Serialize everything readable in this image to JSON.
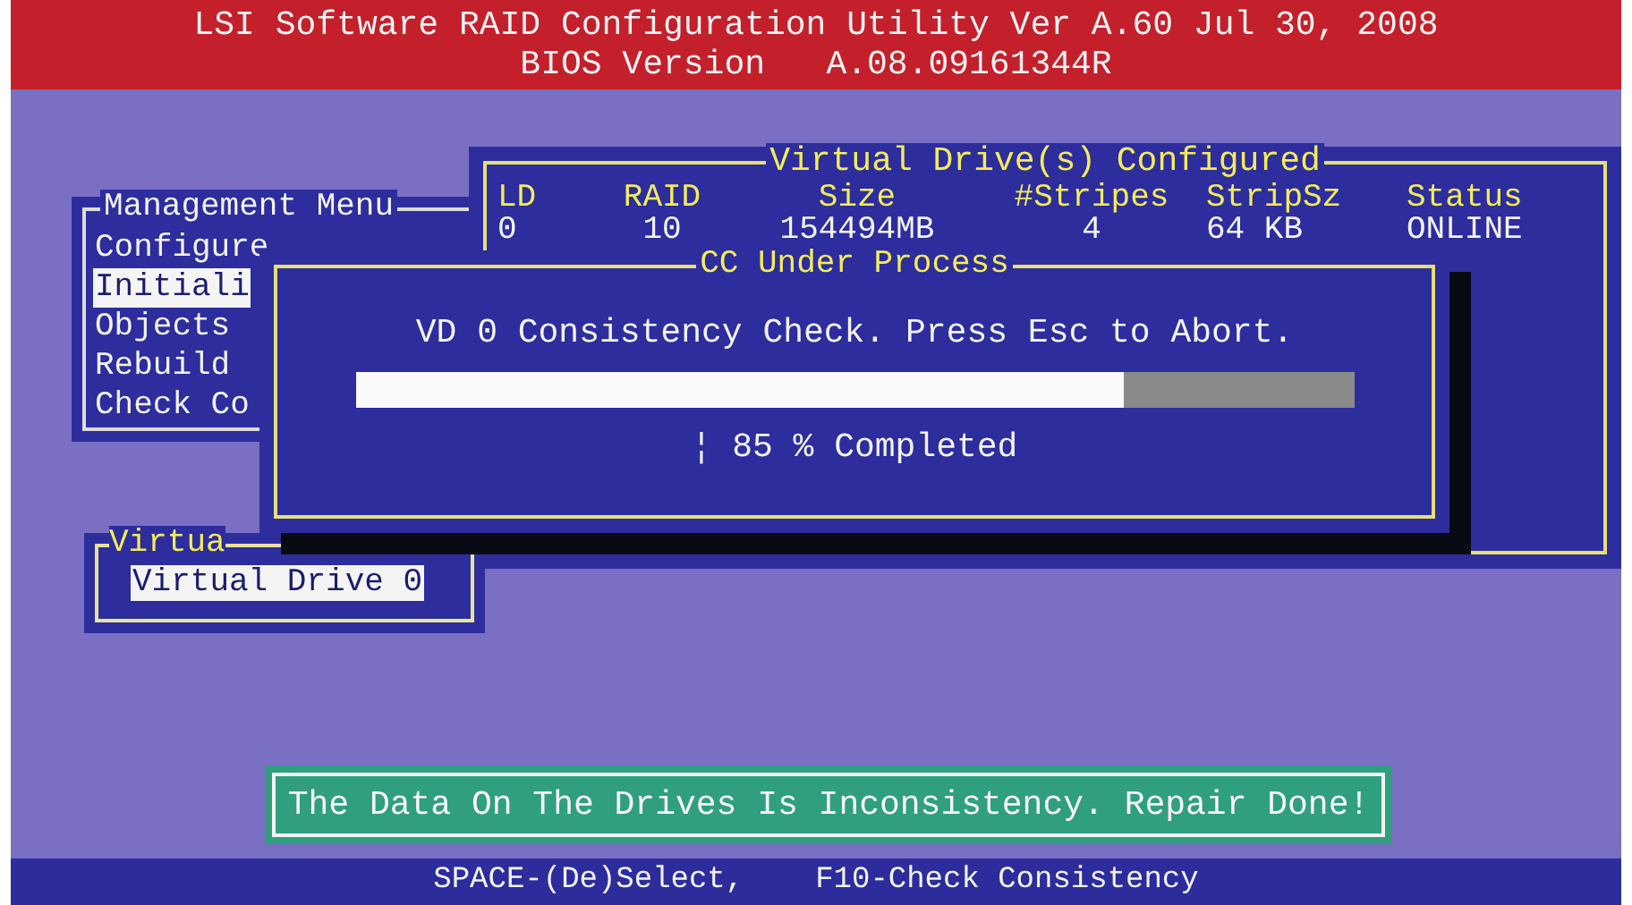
{
  "header": {
    "title": "LSI Software RAID Configuration Utility Ver A.60 Jul 30, 2008",
    "subtitle": "BIOS Version   A.08.09161344R"
  },
  "management_menu": {
    "title": "Management Menu",
    "items": [
      {
        "label": "Configure",
        "selected": false
      },
      {
        "label": "Initiali",
        "selected": true
      },
      {
        "label": "Objects",
        "selected": false
      },
      {
        "label": "Rebuild",
        "selected": false
      },
      {
        "label": "Check Co",
        "selected": false
      }
    ]
  },
  "virtual_drives_configured": {
    "title": "Virtual Drive(s) Configured",
    "columns": [
      "LD",
      "RAID",
      "Size",
      "#Stripes",
      "StripSz",
      "Status"
    ],
    "rows": [
      [
        "0",
        "10",
        "154494MB",
        "4",
        "64 KB",
        "ONLINE"
      ]
    ]
  },
  "virtual_drives_panel": {
    "title": "Virtua",
    "items": [
      {
        "label": "Virtual Drive 0",
        "selected": true
      }
    ]
  },
  "progress_dialog": {
    "title": "CC Under Process",
    "message": "VD 0 Consistency Check. Press Esc to Abort.",
    "level": 0.77,
    "status": "¦ 85 % Completed"
  },
  "notice": "The Data On The Drives Is Inconsistency. Repair Done!",
  "status_bar": [
    "SPACE-(De)Select,",
    "F10-Check Consistency"
  ]
}
